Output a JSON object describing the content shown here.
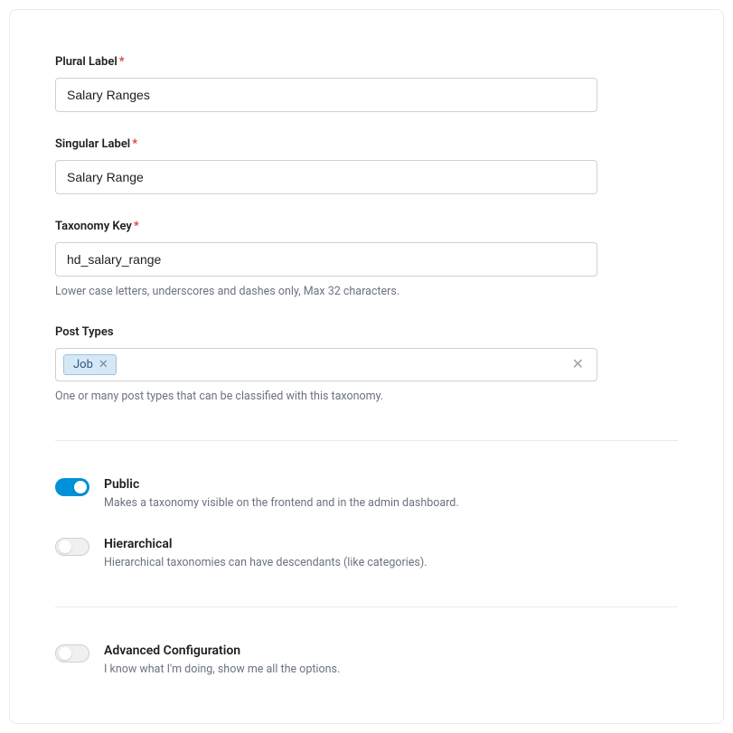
{
  "fields": {
    "pluralLabel": {
      "label": "Plural Label",
      "value": "Salary Ranges"
    },
    "singularLabel": {
      "label": "Singular Label",
      "value": "Salary Range"
    },
    "taxonomyKey": {
      "label": "Taxonomy Key",
      "value": "hd_salary_range",
      "help": "Lower case letters, underscores and dashes only, Max 32 characters."
    },
    "postTypes": {
      "label": "Post Types",
      "tokens": [
        "Job"
      ],
      "help": "One or many post types that can be classified with this taxonomy."
    }
  },
  "toggles": {
    "public": {
      "title": "Public",
      "desc": "Makes a taxonomy visible on the frontend and in the admin dashboard.",
      "on": true
    },
    "hierarchical": {
      "title": "Hierarchical",
      "desc": "Hierarchical taxonomies can have descendants (like categories).",
      "on": false
    },
    "advanced": {
      "title": "Advanced Configuration",
      "desc": "I know what I'm doing, show me all the options.",
      "on": false
    }
  }
}
